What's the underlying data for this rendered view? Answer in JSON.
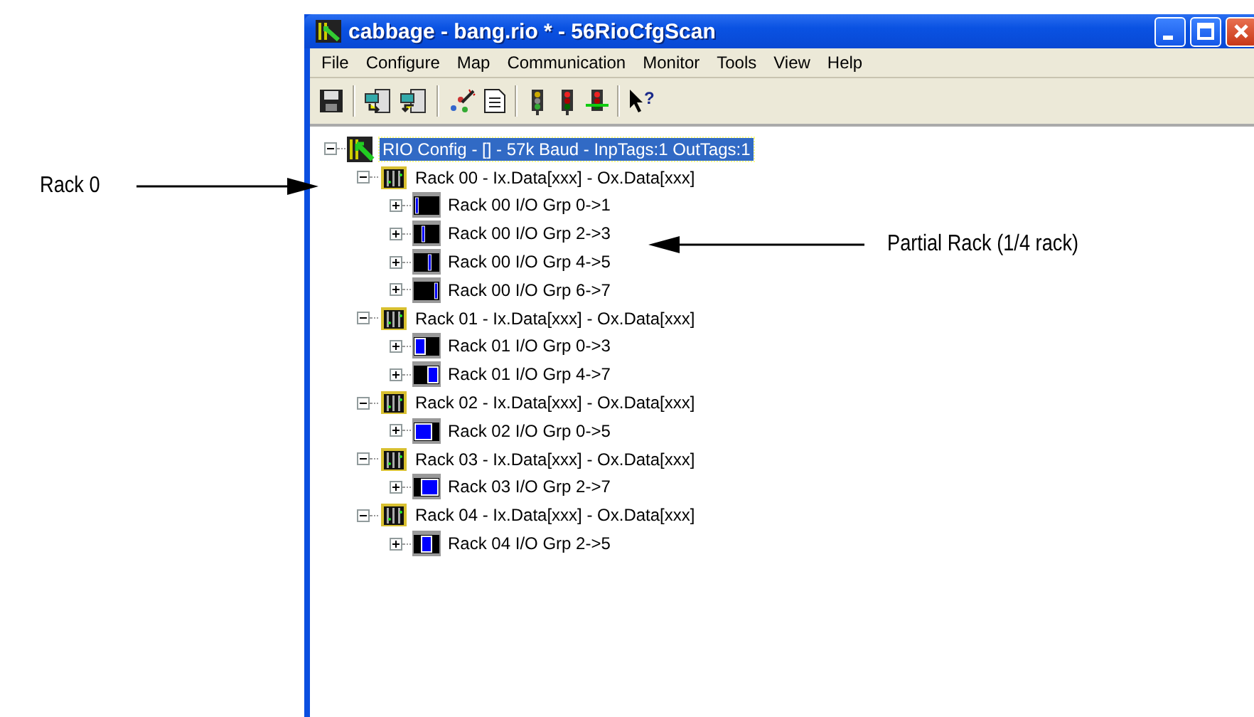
{
  "window": {
    "title": "cabbage - bang.rio * - 56RioCfgScan"
  },
  "menu": [
    "File",
    "Configure",
    "Map",
    "Communication",
    "Monitor",
    "Tools",
    "View",
    "Help"
  ],
  "toolbar": [
    {
      "kind": "save"
    },
    {
      "kind": "sep"
    },
    {
      "kind": "download"
    },
    {
      "kind": "upload"
    },
    {
      "kind": "sep"
    },
    {
      "kind": "wizard"
    },
    {
      "kind": "document"
    },
    {
      "kind": "sep"
    },
    {
      "kind": "light-off"
    },
    {
      "kind": "light-red"
    },
    {
      "kind": "light-green"
    },
    {
      "kind": "sep"
    },
    {
      "kind": "help",
      "glyph": "?"
    }
  ],
  "tree": {
    "kind": "config",
    "label": "RIO Config - [] -  57k Baud - InpTags:1 OutTags:1",
    "selected": true,
    "expanded": true,
    "children": [
      {
        "kind": "rack",
        "label": "Rack 00 - Ix.Data[xxx] - Ox.Data[xxx]",
        "selected": false,
        "expanded": true,
        "children": [
          {
            "kind": "q1",
            "label": "Rack 00 I/O Grp 0->1",
            "selected": false,
            "expanded": false
          },
          {
            "kind": "q2",
            "label": "Rack 00 I/O Grp 2->3",
            "selected": false,
            "expanded": false
          },
          {
            "kind": "q3",
            "label": "Rack 00 I/O Grp 4->5",
            "selected": false,
            "expanded": false
          },
          {
            "kind": "q4",
            "label": "Rack 00 I/O Grp 6->7",
            "selected": false,
            "expanded": false
          }
        ]
      },
      {
        "kind": "rack",
        "label": "Rack 01 - Ix.Data[xxx] - Ox.Data[xxx]",
        "selected": false,
        "expanded": true,
        "children": [
          {
            "kind": "q12",
            "label": "Rack 01 I/O Grp 0->3",
            "selected": false,
            "expanded": false
          },
          {
            "kind": "q34",
            "label": "Rack 01 I/O Grp 4->7",
            "selected": false,
            "expanded": false
          }
        ]
      },
      {
        "kind": "rack",
        "label": "Rack 02 - Ix.Data[xxx] - Ox.Data[xxx]",
        "selected": false,
        "expanded": true,
        "children": [
          {
            "kind": "q123",
            "label": "Rack 02 I/O Grp 0->5",
            "selected": false,
            "expanded": false
          }
        ]
      },
      {
        "kind": "rack",
        "label": "Rack 03 - Ix.Data[xxx] - Ox.Data[xxx]",
        "selected": false,
        "expanded": true,
        "children": [
          {
            "kind": "q234",
            "label": "Rack 03 I/O Grp 2->7",
            "selected": false,
            "expanded": false
          }
        ]
      },
      {
        "kind": "rack",
        "label": "Rack 04 - Ix.Data[xxx] - Ox.Data[xxx]",
        "selected": false,
        "expanded": true,
        "children": [
          {
            "kind": "q23",
            "label": "Rack 04 I/O Grp 2->5",
            "selected": false,
            "expanded": false
          }
        ]
      }
    ]
  },
  "callouts": [
    {
      "text": "Rack 0"
    },
    {
      "text": "Partial Rack (1/4 rack)"
    }
  ]
}
